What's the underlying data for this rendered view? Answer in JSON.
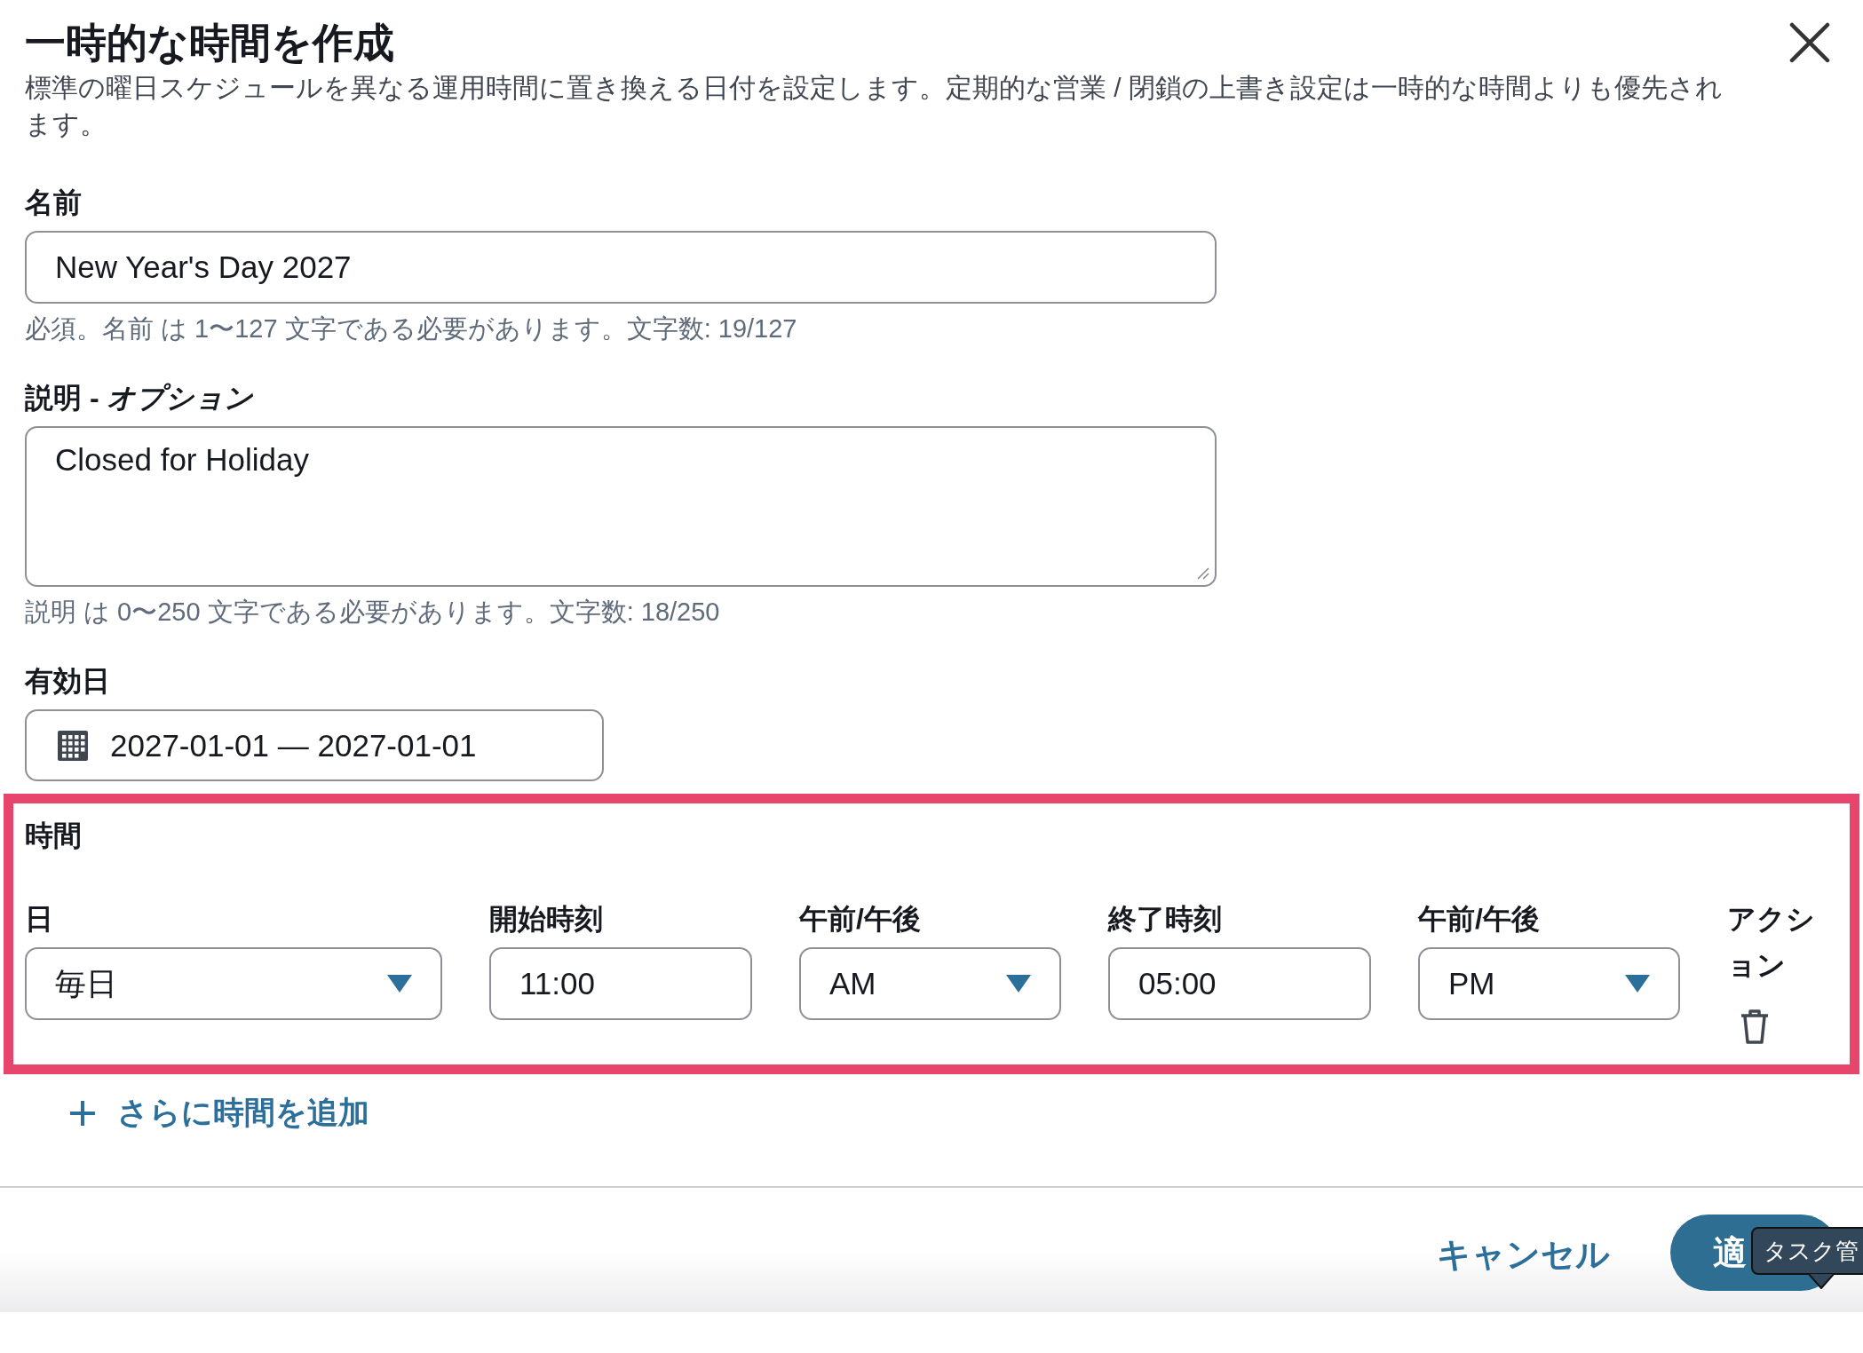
{
  "dialog": {
    "title": "一時的な時間を作成",
    "description": "標準の曜日スケジュールを異なる運用時間に置き換える日付を設定します。定期的な営業 / 閉鎖の上書き設定は一時的な時間よりも優先されます。"
  },
  "name_field": {
    "label": "名前",
    "value": "New Year's Day 2027",
    "hint": "必須。名前 は 1〜127 文字である必要があります。文字数: 19/127"
  },
  "description_field": {
    "label": "説明 - *オプション*",
    "value": "Closed for Holiday",
    "hint": "説明 は 0〜250 文字である必要があります。文字数: 18/250"
  },
  "effective_date": {
    "label": "有効日",
    "value": "2027-01-01 — 2027-01-01"
  },
  "hours": {
    "title": "時間",
    "highlighted": true,
    "columns": [
      "日",
      "開始時刻",
      "午前/午後",
      "終了時刻",
      "午前/午後",
      "アクション"
    ],
    "rows": [
      {
        "cells": [
          {
            "kind": "select",
            "value": "毎日"
          },
          {
            "kind": "input",
            "value": "11:00"
          },
          {
            "kind": "select",
            "value": "AM"
          },
          {
            "kind": "input",
            "value": "05:00"
          },
          {
            "kind": "select",
            "value": "PM"
          },
          {
            "kind": "delete"
          }
        ]
      }
    ]
  },
  "add_link": "さらに時間を追加",
  "footer": {
    "cancel": "キャンセル",
    "primary": "適",
    "tooltip": "タスク管"
  }
}
